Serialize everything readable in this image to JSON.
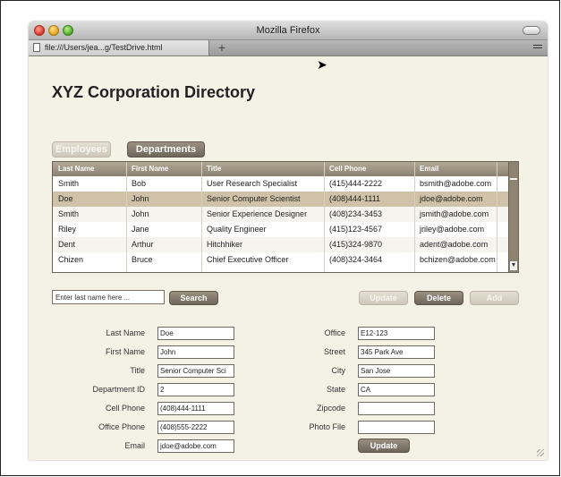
{
  "window": {
    "title": "Mozilla Firefox"
  },
  "browser": {
    "tab_label": "file:///Users/jea...g/TestDrive.html",
    "new_tab_label": "+"
  },
  "app": {
    "title": "XYZ Corporation Directory",
    "tabs": [
      {
        "label": "Employees",
        "active": false
      },
      {
        "label": "Departments",
        "active": true
      }
    ]
  },
  "grid": {
    "columns": [
      "Last Name",
      "First Name",
      "Title",
      "Cell Phone",
      "Email"
    ],
    "rows": [
      [
        "Smith",
        "Bob",
        "User Research Specialist",
        "(415)444-2222",
        "bsmith@adobe.com"
      ],
      [
        "Doe",
        "John",
        "Senior Computer Scientist",
        "(408)444-1111",
        "jdoe@adobe.com"
      ],
      [
        "Smith",
        "John",
        "Senior Experience Designer",
        "(408)234-3453",
        "jsmith@adobe.com"
      ],
      [
        "Riley",
        "Jane",
        "Quality Engineer",
        "(415)123-4567",
        "jriley@adobe.com"
      ],
      [
        "Dent",
        "Arthur",
        "Hitchhiker",
        "(415)324-9870",
        "adent@adobe.com"
      ],
      [
        "Chizen",
        "Bruce",
        "Chief Executive Officer",
        "(408)324-3464",
        "bchizen@adobe.com"
      ]
    ],
    "selected_row": 1
  },
  "search": {
    "value": "Enter last name here ...",
    "button_label": "Search"
  },
  "actions": {
    "update_label": "Update",
    "delete_label": "Delete",
    "add_label": "Add"
  },
  "form": {
    "left": [
      {
        "label": "Last Name",
        "value": "Doe"
      },
      {
        "label": "First Name",
        "value": "John"
      },
      {
        "label": "Title",
        "value": "Senior Computer Sci"
      },
      {
        "label": "Department ID",
        "value": "2"
      },
      {
        "label": "Cell Phone",
        "value": "(408)444-1111"
      },
      {
        "label": "Office Phone",
        "value": "(408)555-2222"
      },
      {
        "label": "Email",
        "value": "jdoe@adobe.com"
      }
    ],
    "right": [
      {
        "label": "Office",
        "value": "E12-123"
      },
      {
        "label": "Street",
        "value": "345 Park Ave"
      },
      {
        "label": "City",
        "value": "San Jose"
      },
      {
        "label": "State",
        "value": "CA"
      },
      {
        "label": "Zipcode",
        "value": ""
      },
      {
        "label": "Photo File",
        "value": ""
      }
    ],
    "update_label": "Update"
  },
  "colors": {
    "accent_button": "#7f7569",
    "selected_row": "#cfc2a8",
    "panel_bg": "#f4f1e5"
  }
}
